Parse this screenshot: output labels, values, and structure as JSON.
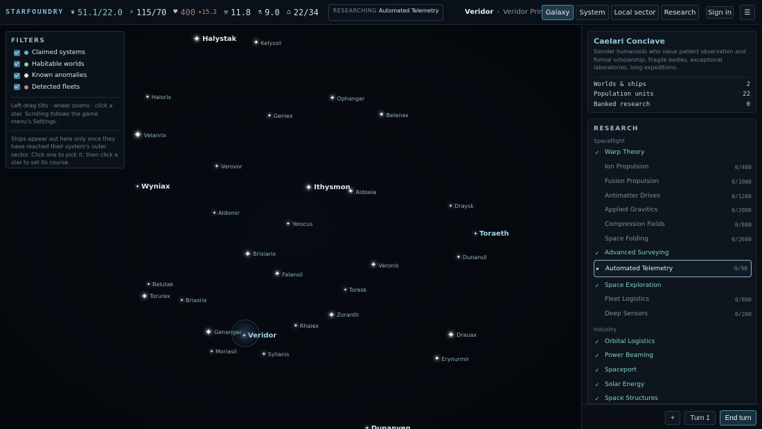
{
  "app": {
    "brand": "STARFOUNDRY"
  },
  "resources": [
    {
      "icon": "leaf-icon",
      "glyph": "❦",
      "value": "51.1/22.0",
      "sub": "",
      "style": "green"
    },
    {
      "icon": "energy-icon",
      "glyph": "⚡",
      "value": "115/70",
      "sub": "",
      "style": ""
    },
    {
      "icon": "heart-icon",
      "glyph": "♥",
      "value": "400",
      "sub": "+15.2",
      "style": "muted"
    },
    {
      "icon": "pickaxe-icon",
      "glyph": "⚒",
      "value": "11.8",
      "sub": "",
      "style": ""
    },
    {
      "icon": "flask-icon",
      "glyph": "⚗",
      "value": "9.0",
      "sub": "",
      "style": ""
    },
    {
      "icon": "population-icon",
      "glyph": "⌂",
      "value": "22/34",
      "sub": "",
      "style": ""
    }
  ],
  "researching": {
    "label": "RESEARCHING",
    "value": "Automated Telemetry"
  },
  "location": {
    "system": "Veridor",
    "body": "Veridor Prime"
  },
  "nav": {
    "galaxy": "Galaxy",
    "system": "System",
    "local": "Local sector",
    "research": "Research",
    "signin": "Sign in",
    "menu_glyph": "☰"
  },
  "filters": {
    "title": "FILTERS",
    "items": [
      {
        "label": "Claimed systems",
        "color": "#6fb6c8"
      },
      {
        "label": "Habitable worlds",
        "color": "#7fd0b0"
      },
      {
        "label": "Known anomalies",
        "color": "#dde3ea"
      },
      {
        "label": "Detected fleets",
        "color": "#b08a86"
      }
    ],
    "help1": "Left-drag tilts · wheel zooms · click a star. Scrolling follows the game menu's Settings.",
    "help2": "Ships appear out here only once they have reached their system's outer sector. Click one to pick it, then click a star to set its course."
  },
  "stars": [
    {
      "name": "Halystak",
      "kind": "big"
    },
    {
      "name": "Kelyssil",
      "kind": ""
    },
    {
      "name": "Halorix",
      "kind": ""
    },
    {
      "name": "Ophangar",
      "kind": ""
    },
    {
      "name": "Geniex",
      "kind": ""
    },
    {
      "name": "Belanax",
      "kind": ""
    },
    {
      "name": "Velanrix",
      "kind": ""
    },
    {
      "name": "Verovor",
      "kind": ""
    },
    {
      "name": "Wyniax",
      "kind": "big"
    },
    {
      "name": "Ithysmon",
      "kind": "big"
    },
    {
      "name": "Aldoeia",
      "kind": ""
    },
    {
      "name": "Draysk",
      "kind": ""
    },
    {
      "name": "Aldomir",
      "kind": ""
    },
    {
      "name": "Yelocus",
      "kind": ""
    },
    {
      "name": "Toraeth",
      "kind": "teal"
    },
    {
      "name": "Brixiarix",
      "kind": ""
    },
    {
      "name": "Dunansil",
      "kind": ""
    },
    {
      "name": "Veronis",
      "kind": ""
    },
    {
      "name": "Falansil",
      "kind": ""
    },
    {
      "name": "Belutak",
      "kind": ""
    },
    {
      "name": "Toresk",
      "kind": ""
    },
    {
      "name": "Torurex",
      "kind": ""
    },
    {
      "name": "Brixorix",
      "kind": ""
    },
    {
      "name": "Zoranth",
      "kind": ""
    },
    {
      "name": "Rhaiex",
      "kind": ""
    },
    {
      "name": "Genangar",
      "kind": ""
    },
    {
      "name": "Veridor",
      "kind": "claimed"
    },
    {
      "name": "Drauax",
      "kind": ""
    },
    {
      "name": "Moriasil",
      "kind": ""
    },
    {
      "name": "Sylianis",
      "kind": ""
    },
    {
      "name": "Erynurmir",
      "kind": ""
    },
    {
      "name": "Dunanven",
      "kind": "big"
    }
  ],
  "civ": {
    "name": "Caelari Conclave",
    "desc": "Slender humanoids who value patient observation and formal scholarship. Fragile bodies, exceptional laboratories, long expeditions.",
    "stats": [
      {
        "label": "Worlds & ships",
        "value": "2"
      },
      {
        "label": "Population units",
        "value": "22"
      },
      {
        "label": "Banked research",
        "value": "0"
      }
    ]
  },
  "research": {
    "title": "RESEARCH",
    "categories": [
      "Spaceflight",
      "Industry"
    ],
    "techs": [
      {
        "name": "Warp Theory",
        "status": "done",
        "progress": ""
      },
      {
        "name": "Ion Propulsion",
        "status": "locked",
        "progress": "0/400"
      },
      {
        "name": "Fusion Propulsion",
        "status": "locked",
        "progress": "0/1000"
      },
      {
        "name": "Antimatter Drives",
        "status": "locked",
        "progress": "0/1200"
      },
      {
        "name": "Applied Gravitics",
        "status": "locked",
        "progress": "0/2000"
      },
      {
        "name": "Compression Fields",
        "status": "locked",
        "progress": "0/800"
      },
      {
        "name": "Space Folding",
        "status": "locked",
        "progress": "0/2600"
      },
      {
        "name": "Advanced Surveying",
        "status": "done",
        "progress": ""
      },
      {
        "name": "Automated Telemetry",
        "status": "current",
        "progress": "0/90"
      },
      {
        "name": "Space Exploration",
        "status": "done",
        "progress": ""
      },
      {
        "name": "Fleet Logistics",
        "status": "locked",
        "progress": "0/800"
      },
      {
        "name": "Deep Sensors",
        "status": "locked",
        "progress": "0/200"
      },
      {
        "name": "Orbital Logistics",
        "status": "done",
        "progress": ""
      },
      {
        "name": "Power Beaming",
        "status": "done",
        "progress": ""
      },
      {
        "name": "Spaceport",
        "status": "done",
        "progress": ""
      },
      {
        "name": "Solar Energy",
        "status": "done",
        "progress": ""
      },
      {
        "name": "Space Structures",
        "status": "done",
        "progress": ""
      }
    ]
  },
  "bottom": {
    "plus_glyph": "+",
    "turn": "Turn 1",
    "end_turn": "End turn"
  }
}
